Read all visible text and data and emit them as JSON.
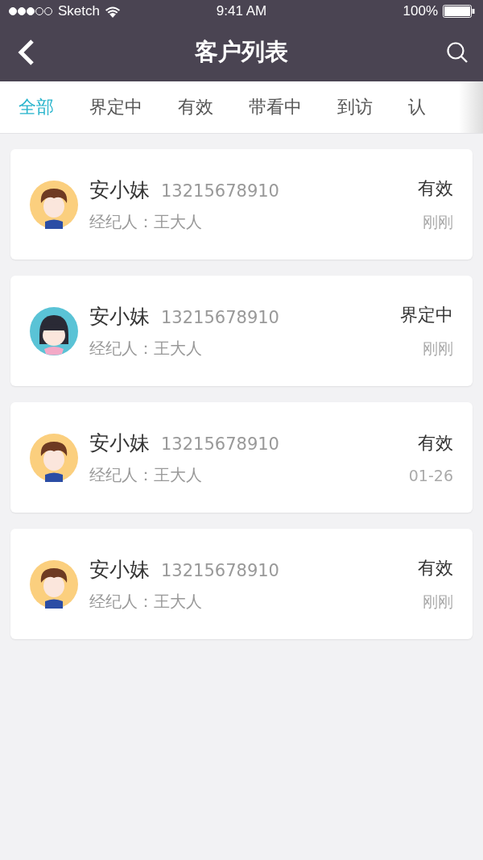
{
  "status_bar": {
    "carrier": "Sketch",
    "time": "9:41 AM",
    "battery": "100%"
  },
  "nav": {
    "title": "客户列表"
  },
  "tabs": [
    {
      "label": "全部",
      "selected": true
    },
    {
      "label": "界定中",
      "selected": false
    },
    {
      "label": "有效",
      "selected": false
    },
    {
      "label": "带看中",
      "selected": false
    },
    {
      "label": "到访",
      "selected": false
    },
    {
      "label": "认",
      "selected": false
    }
  ],
  "customers": [
    {
      "kind": "boy",
      "name": "安小妹",
      "phone": "13215678910",
      "agent": "经纪人：王大人",
      "status": "有效",
      "time": "刚刚"
    },
    {
      "kind": "girl",
      "name": "安小妹",
      "phone": "13215678910",
      "agent": "经纪人：王大人",
      "status": "界定中",
      "time": "刚刚"
    },
    {
      "kind": "boy",
      "name": "安小妹",
      "phone": "13215678910",
      "agent": "经纪人：王大人",
      "status": "有效",
      "time": "01-26"
    },
    {
      "kind": "boy",
      "name": "安小妹",
      "phone": "13215678910",
      "agent": "经纪人：王大人",
      "status": "有效",
      "time": "刚刚"
    }
  ]
}
